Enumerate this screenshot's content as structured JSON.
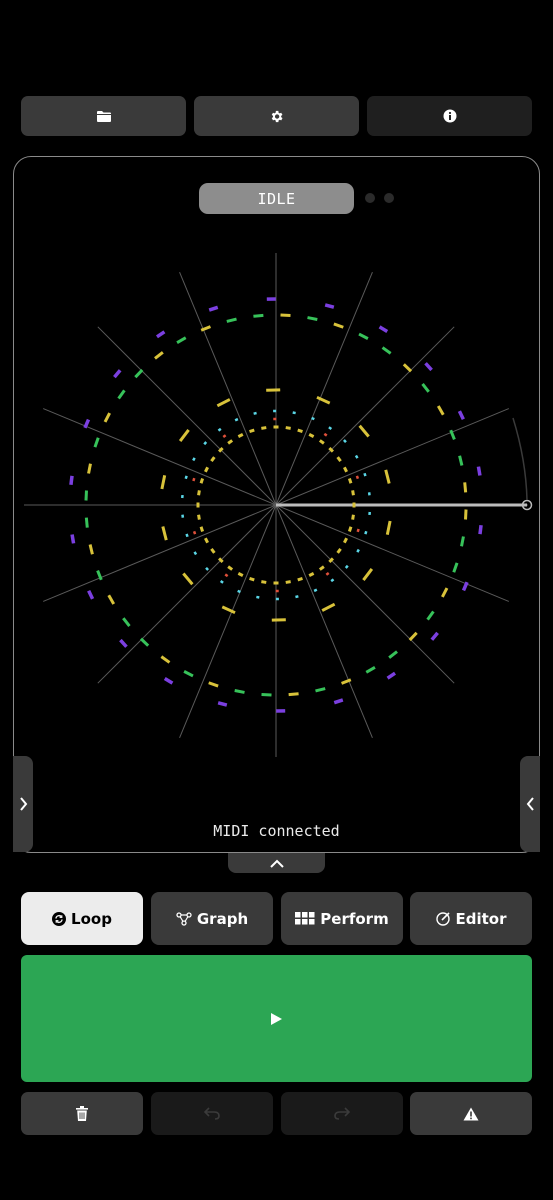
{
  "toolbar": {
    "items": [
      {
        "icon": "folder-icon"
      },
      {
        "icon": "gear-icon"
      },
      {
        "icon": "info-icon"
      }
    ]
  },
  "sequencer": {
    "state_label": "IDLE",
    "status_text": "MIDI connected"
  },
  "tabs": [
    {
      "label": "Loop",
      "icon": "loop-icon",
      "active": true
    },
    {
      "label": "Graph",
      "icon": "graph-icon",
      "active": false
    },
    {
      "label": "Perform",
      "icon": "grid-icon",
      "active": false
    },
    {
      "label": "Editor",
      "icon": "edit-icon",
      "active": false
    }
  ],
  "transport": {
    "play_icon": "play-icon"
  },
  "actions": [
    {
      "icon": "trash-icon",
      "enabled": true
    },
    {
      "icon": "undo-icon",
      "enabled": false
    },
    {
      "icon": "redo-icon",
      "enabled": false
    },
    {
      "icon": "warning-icon",
      "enabled": true
    }
  ],
  "colors": {
    "accent_green": "#2ca654",
    "ring_yellow": "#d8c23a",
    "ring_green": "#37c25a",
    "ring_purple": "#7b3fe0",
    "ring_cyan": "#5ad6e6",
    "ring_red": "#e0503a"
  }
}
